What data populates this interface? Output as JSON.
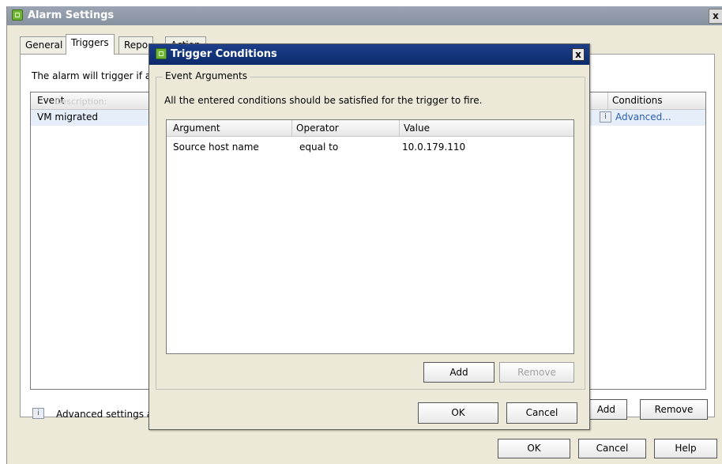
{
  "main_window": {
    "title": "Alarm Settings",
    "close_glyph": "x",
    "tabs": [
      {
        "label": "General"
      },
      {
        "label": "Triggers",
        "active": true
      },
      {
        "label": "Repo"
      },
      {
        "label": "Action"
      }
    ],
    "trigger_description": "The alarm will trigger if a",
    "event_grid": {
      "columns": {
        "event": "Event",
        "event_ghost": "Description:",
        "conditions": "Conditions"
      },
      "rows": [
        {
          "event": "VM migrated",
          "conditions": "Advanced..."
        }
      ]
    },
    "advanced_settings_label": "Advanced settings a",
    "buttons": {
      "add": "Add",
      "remove": "Remove",
      "ok": "OK",
      "cancel": "Cancel",
      "help": "Help"
    }
  },
  "dialog": {
    "title": "Trigger Conditions",
    "close_glyph": "x",
    "group_label": "Event Arguments",
    "note": "All the entered conditions should be satisfied for the trigger to fire.",
    "table": {
      "columns": [
        "Argument",
        "Operator",
        "Value"
      ],
      "rows": [
        {
          "argument": "Source host name",
          "operator": "equal to",
          "value": "10.0.179.110"
        }
      ]
    },
    "buttons": {
      "add": "Add",
      "remove": "Remove",
      "ok": "OK",
      "cancel": "Cancel"
    }
  },
  "icon_names": [
    "app-logo-icon",
    "close-icon",
    "info-icon"
  ],
  "colors": {
    "dialog_titlebar": "#0b2a6b",
    "main_titlebar": "#8792a0",
    "window_bg": "#ece9d8",
    "link": "#2a5db0"
  }
}
